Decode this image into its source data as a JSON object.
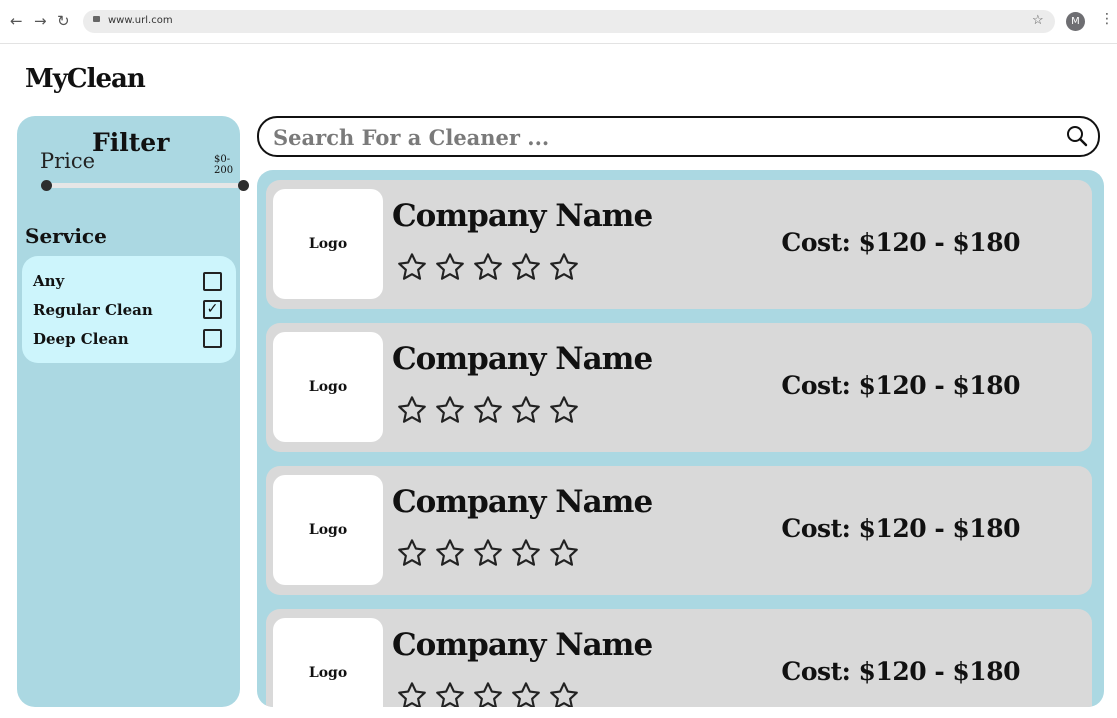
{
  "browser": {
    "url": "www.url.com",
    "avatar_initial": "M"
  },
  "brand": "MyClean",
  "filter": {
    "title": "Filter",
    "price_label": "Price",
    "price_range": "$0-200",
    "price_min": 0,
    "price_max": 200,
    "service_label": "Service",
    "options": [
      {
        "label": "Any",
        "checked": false
      },
      {
        "label": "Regular Clean",
        "checked": true
      },
      {
        "label": "Deep Clean",
        "checked": false
      }
    ]
  },
  "search": {
    "placeholder": "Search For a Cleaner ..."
  },
  "results": [
    {
      "logo": "Logo",
      "name": "Company Name",
      "rating": 0,
      "cost": "Cost: $120 - $180"
    },
    {
      "logo": "Logo",
      "name": "Company Name",
      "rating": 0,
      "cost": "Cost: $120 - $180"
    },
    {
      "logo": "Logo",
      "name": "Company Name",
      "rating": 0,
      "cost": "Cost: $120 - $180"
    },
    {
      "logo": "Logo",
      "name": "Company Name",
      "rating": 0,
      "cost": "Cost: $120 - $180"
    }
  ]
}
